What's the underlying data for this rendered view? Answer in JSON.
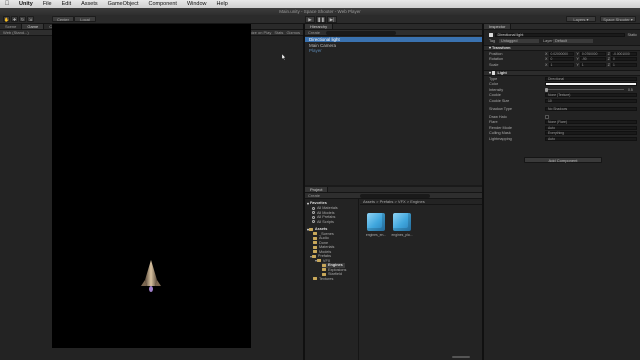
{
  "menubar": {
    "app": "Unity",
    "items": [
      "File",
      "Edit",
      "Assets",
      "GameObject",
      "Component",
      "Window",
      "Help"
    ],
    "right_text": ""
  },
  "titlebar": {
    "title": "Main.unity - Space Shooter - Web Player"
  },
  "toolbar": {
    "pivot_label": "Center",
    "local_label": "Local",
    "layers_label": "Layers",
    "layout_label": "Space Shooter"
  },
  "game_panel": {
    "tabs": [
      "Scene",
      "Game",
      "Console"
    ],
    "aspect_label": "Web (Stand...)",
    "maximize_label": "Maximize on Play",
    "stats_label": "Stats",
    "gizmos_label": "Gizmos",
    "background_color": "#000000"
  },
  "hierarchy": {
    "tab": "Hierarchy",
    "create_label": "Create",
    "items": [
      {
        "label": "Directional light",
        "selected": true
      },
      {
        "label": "Main Camera",
        "selected": false
      },
      {
        "label": "Player",
        "selected": false
      }
    ]
  },
  "project": {
    "tab": "Project",
    "create_label": "Create",
    "breadcrumb": "Assets > Prefabs > VFX > Engines",
    "favorites": {
      "label": "Favorites",
      "items": [
        "All Materials",
        "All Models",
        "All Prefabs",
        "All Scripts"
      ]
    },
    "assets_tree": [
      {
        "label": "Assets",
        "depth": 0,
        "bold": false
      },
      {
        "label": "_Scenes",
        "depth": 1,
        "bold": false
      },
      {
        "label": "Audio",
        "depth": 1,
        "bold": false
      },
      {
        "label": "Done",
        "depth": 1,
        "bold": false
      },
      {
        "label": "Materials",
        "depth": 1,
        "bold": false
      },
      {
        "label": "Models",
        "depth": 1,
        "bold": false
      },
      {
        "label": "Prefabs",
        "depth": 1,
        "bold": false
      },
      {
        "label": "VFX",
        "depth": 2,
        "bold": false
      },
      {
        "label": "Engines",
        "depth": 3,
        "bold": true
      },
      {
        "label": "Explosions",
        "depth": 3,
        "bold": false
      },
      {
        "label": "Starfield",
        "depth": 3,
        "bold": false
      },
      {
        "label": "Textures",
        "depth": 1,
        "bold": false
      }
    ],
    "assets": [
      {
        "name": "engines_en..."
      },
      {
        "name": "engines_pla..."
      }
    ]
  },
  "inspector": {
    "tab": "Inspector",
    "object_name": "Directional light",
    "static_label": "Static",
    "tag_label": "Tag",
    "tag_value": "Untagged",
    "layer_label": "Layer",
    "layer_value": "Default",
    "transform": {
      "header": "Transform",
      "position": {
        "label": "Position",
        "x": "0.02000000",
        "y": "0.0760000",
        "z": "-0.0001000"
      },
      "rotation": {
        "label": "Rotation",
        "x": "0",
        "y": "-90",
        "z": "0"
      },
      "scale": {
        "label": "Scale",
        "x": "1",
        "y": "1",
        "z": "1"
      }
    },
    "light": {
      "header": "Light",
      "rows": [
        {
          "label": "Type",
          "value": "Directional"
        },
        {
          "label": "Color",
          "value": ""
        },
        {
          "label": "Intensity",
          "value": "0.5"
        },
        {
          "label": "Cookie",
          "value": "None (Texture)"
        },
        {
          "label": "Cookie Size",
          "value": "10"
        },
        {
          "label": "Shadow Type",
          "value": "No Shadows"
        },
        {
          "label": "Draw Halo",
          "value": ""
        },
        {
          "label": "Flare",
          "value": "None (Flare)"
        },
        {
          "label": "Render Mode",
          "value": "Auto"
        },
        {
          "label": "Culling Mask",
          "value": "Everything"
        },
        {
          "label": "Lightmapping",
          "value": "Auto"
        }
      ]
    },
    "add_component_label": "Add Component"
  }
}
